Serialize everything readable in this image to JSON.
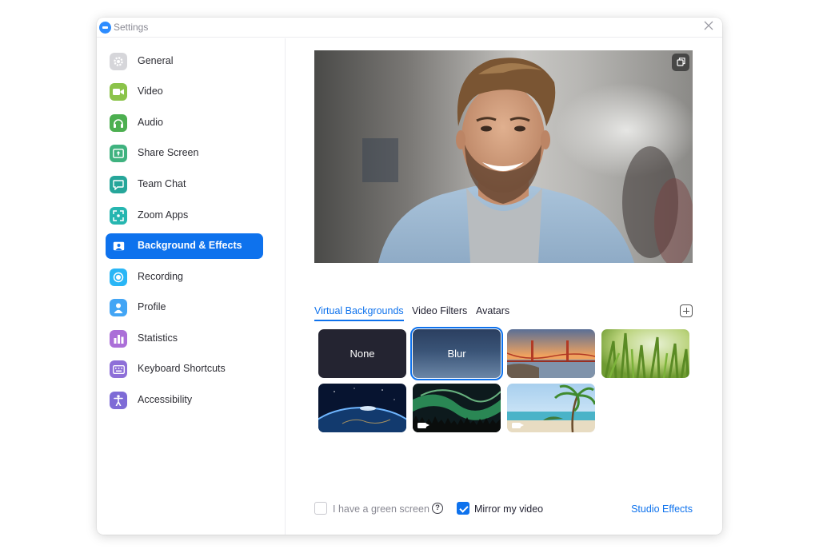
{
  "window": {
    "title": "Settings"
  },
  "sidebar": {
    "items": [
      {
        "label": "General",
        "icon": "gear-icon",
        "color": "#d6d6da"
      },
      {
        "label": "Video",
        "icon": "video-camera-icon",
        "color": "#8bc34a"
      },
      {
        "label": "Audio",
        "icon": "headphones-icon",
        "color": "#4caf50"
      },
      {
        "label": "Share Screen",
        "icon": "share-screen-icon",
        "color": "#3fb27f"
      },
      {
        "label": "Team Chat",
        "icon": "chat-bubble-icon",
        "color": "#26a69a"
      },
      {
        "label": "Zoom Apps",
        "icon": "apps-icon",
        "color": "#26b6b0"
      },
      {
        "label": "Background & Effects",
        "icon": "background-icon",
        "color": "#0e72ed",
        "active": true
      },
      {
        "label": "Recording",
        "icon": "record-icon",
        "color": "#29b6f6"
      },
      {
        "label": "Profile",
        "icon": "person-icon",
        "color": "#42a5f5"
      },
      {
        "label": "Statistics",
        "icon": "bar-chart-icon",
        "color": "#ab6fd8"
      },
      {
        "label": "Keyboard Shortcuts",
        "icon": "keyboard-icon",
        "color": "#8e6fd8"
      },
      {
        "label": "Accessibility",
        "icon": "accessibility-icon",
        "color": "#7e6bd6"
      }
    ]
  },
  "tabs": [
    {
      "label": "Virtual Backgrounds",
      "active": true
    },
    {
      "label": "Video Filters",
      "active": false
    },
    {
      "label": "Avatars",
      "active": false
    }
  ],
  "backgrounds": [
    {
      "label": "None",
      "kind": "none"
    },
    {
      "label": "Blur",
      "kind": "blur",
      "selected": true
    },
    {
      "label": "",
      "kind": "golden-gate"
    },
    {
      "label": "",
      "kind": "grass"
    },
    {
      "label": "",
      "kind": "earth"
    },
    {
      "label": "",
      "kind": "aurora",
      "video": true
    },
    {
      "label": "",
      "kind": "beach",
      "video": true
    }
  ],
  "options": {
    "green_screen_label": "I have a green screen",
    "green_screen_checked": false,
    "mirror_label": "Mirror my video",
    "mirror_checked": true,
    "studio_effects": "Studio Effects"
  }
}
